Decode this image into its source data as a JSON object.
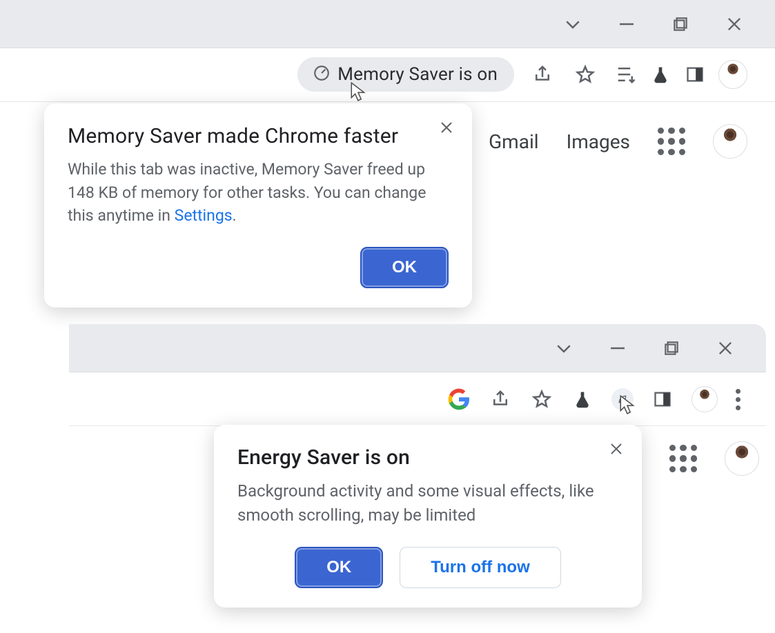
{
  "window1": {
    "omnibox": {
      "memory_chip_label": "Memory Saver is on"
    },
    "page_nav": {
      "gmail": "Gmail",
      "images": "Images"
    },
    "popup": {
      "title": "Memory Saver made Chrome faster",
      "body_pre": "While this tab was inactive, Memory Saver freed up 148 KB of memory for other tasks. You can change this anytime in ",
      "body_link": "Settings",
      "body_post": ".",
      "ok": "OK"
    }
  },
  "window2": {
    "popup": {
      "title": "Energy Saver is on",
      "body": "Background activity and some visual effects, like smooth scrolling, may be limited",
      "ok": "OK",
      "turn_off": "Turn off now"
    }
  }
}
